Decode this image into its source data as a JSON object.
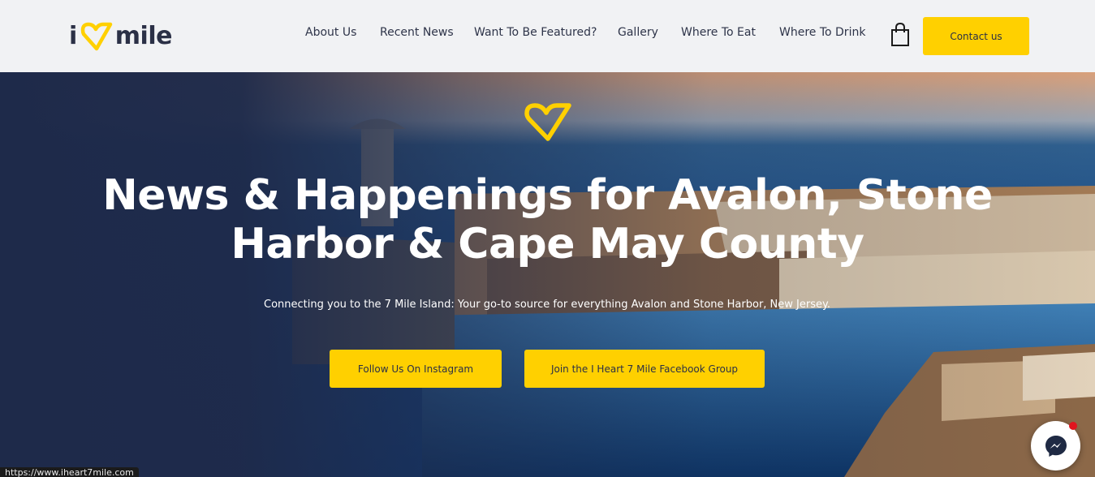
{
  "brand": {
    "logo_prefix": "i",
    "logo_suffix": "mile",
    "logo_icon": "heart-7-icon",
    "accent_color": "#ffd000",
    "text_color": "#2b3046"
  },
  "nav": {
    "items": [
      {
        "label": "About Us"
      },
      {
        "label": "Recent News"
      },
      {
        "label": "Want To Be Featured?"
      },
      {
        "label": "Gallery"
      },
      {
        "label": "Where To Eat"
      },
      {
        "label": "Where To Drink"
      }
    ],
    "cart_icon": "shopping-bag-icon",
    "contact_label": "Contact us"
  },
  "hero": {
    "icon": "heart-7-icon",
    "title_line1": "News & Happenings for Avalon, Stone",
    "title_line2": "Harbor & Cape May County",
    "subtitle": "Connecting you to the 7 Mile Island: Your go-to source for everything Avalon and Stone Harbor, New Jersey.",
    "button_instagram": "Follow Us On Instagram",
    "button_facebook": "Join the I Heart 7 Mile Facebook Group"
  },
  "chat": {
    "icon": "messenger-icon"
  },
  "status_bar": {
    "url": "https://www.iheart7mile.com"
  }
}
